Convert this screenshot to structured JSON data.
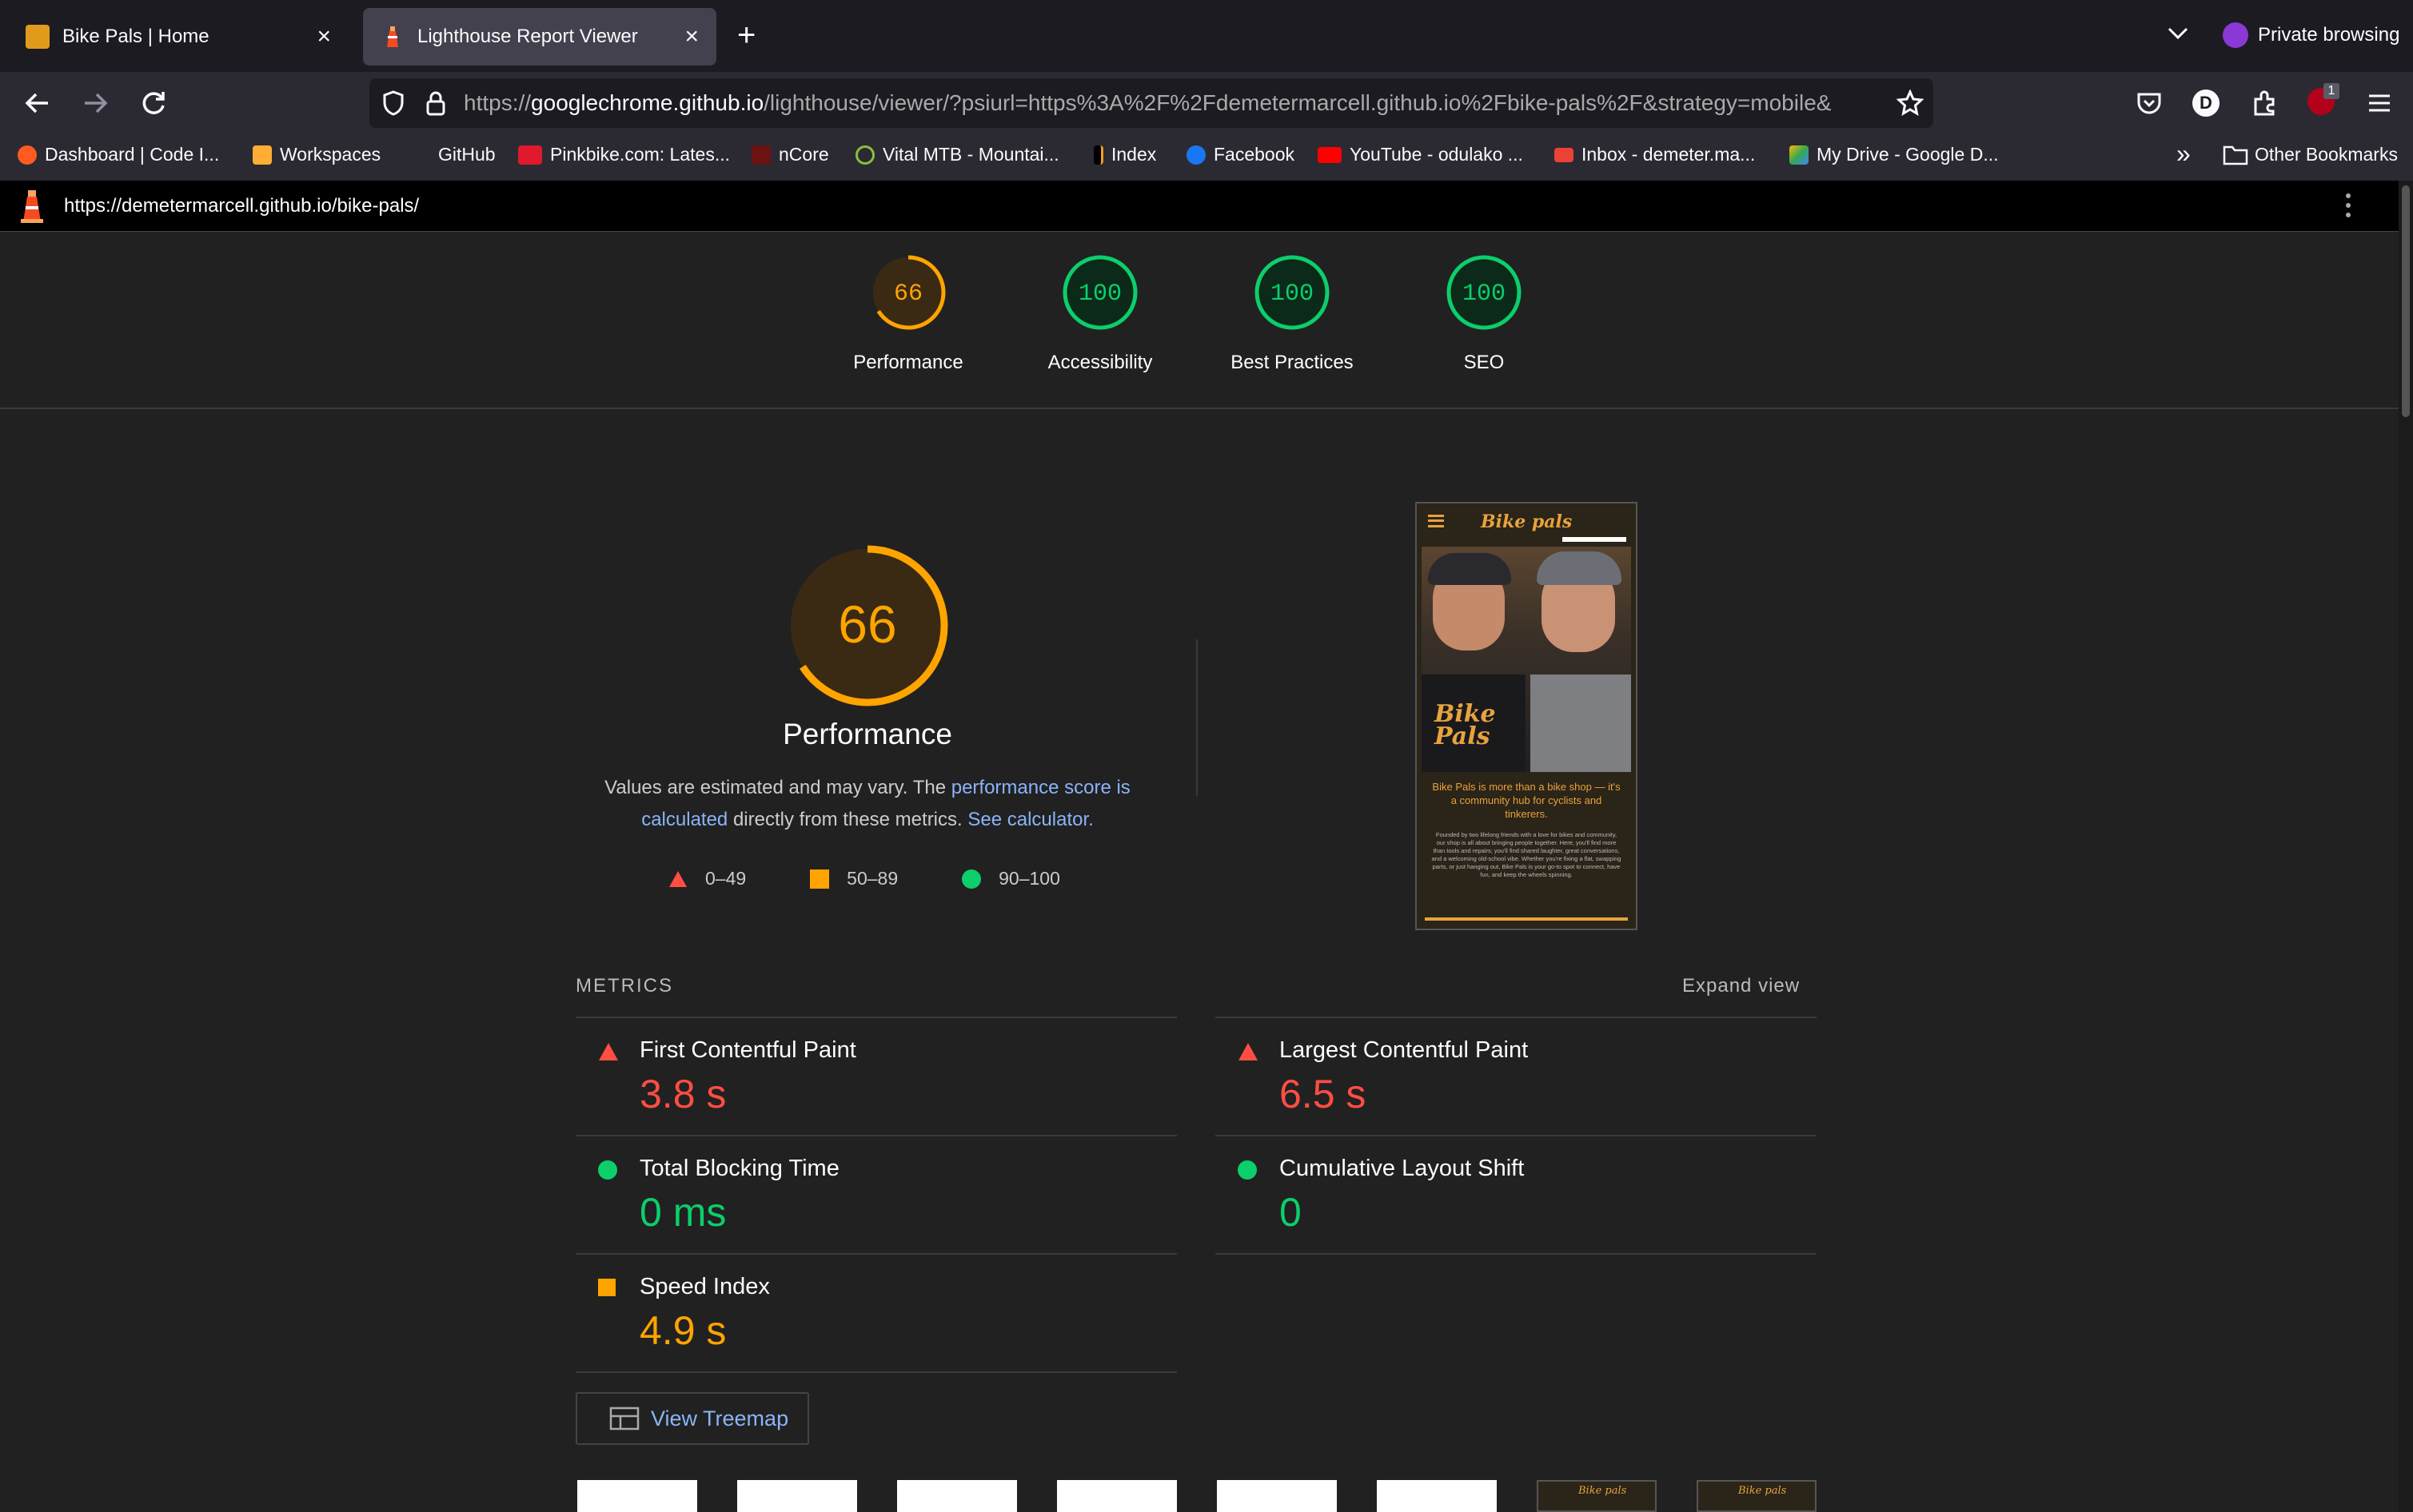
{
  "browser": {
    "tabs": [
      {
        "title": "Bike Pals | Home",
        "active": false
      },
      {
        "title": "Lighthouse Report Viewer",
        "active": true
      }
    ],
    "private_label": "Private browsing",
    "url_scheme": "https://",
    "url_host": "googlechrome.github.io",
    "url_rest": "/lighthouse/viewer/?psiurl=https%3A%2F%2Fdemetermarcell.github.io%2Fbike-pals%2F&strategy=mobile&",
    "bookmarks": [
      "Dashboard | Code I...",
      "Workspaces",
      "GitHub",
      "Pinkbike.com: Lates...",
      "nCore",
      "Vital MTB - Mountai...",
      "Index",
      "Facebook",
      "YouTube - odulako ...",
      "Inbox - demeter.ma...",
      "My Drive - Google D..."
    ],
    "other_bookmarks": "Other Bookmarks",
    "extension_badge": "1",
    "profile_letter": "D"
  },
  "lighthouse": {
    "report_url": "https://demetermarcell.github.io/bike-pals/",
    "scores": [
      {
        "label": "Performance",
        "value": "66",
        "color": "#ffa400",
        "fraction": 0.66
      },
      {
        "label": "Accessibility",
        "value": "100",
        "color": "#0cce6b",
        "fraction": 1.0
      },
      {
        "label": "Best Practices",
        "value": "100",
        "color": "#0cce6b",
        "fraction": 1.0
      },
      {
        "label": "SEO",
        "value": "100",
        "color": "#0cce6b",
        "fraction": 1.0
      }
    ],
    "main_score": "66",
    "main_label": "Performance",
    "desc_prefix": "Values are estimated and may vary. The ",
    "desc_link1": "performance score is calculated",
    "desc_mid": " directly from these metrics. ",
    "desc_link2": "See calculator.",
    "legend": [
      "0–49",
      "50–89",
      "90–100"
    ],
    "metrics_title": "METRICS",
    "expand_view": "Expand view",
    "metrics": [
      {
        "name": "First Contentful Paint",
        "value": "3.8 s",
        "status": "fail"
      },
      {
        "name": "Largest Contentful Paint",
        "value": "6.5 s",
        "status": "fail"
      },
      {
        "name": "Total Blocking Time",
        "value": "0 ms",
        "status": "pass"
      },
      {
        "name": "Cumulative Layout Shift",
        "value": "0",
        "status": "pass"
      },
      {
        "name": "Speed Index",
        "value": "4.9 s",
        "status": "average"
      }
    ],
    "treemap_button": "View Treemap",
    "screenshot": {
      "brand": "Bike pals",
      "logo_line1": "Bike",
      "logo_line2": "Pals",
      "tagline": "Bike Pals is more than a bike shop — it's a community hub for cyclists and tinkerers.",
      "body": "Founded by two lifelong friends with a love for bikes and community, our shop is all about bringing people together. Here, you'll find more than tools and repairs; you'll find shared laughter, great conversations, and a welcoming old-school vibe. Whether you're fixing a flat, swapping parts, or just hanging out, Bike Pals is your go-to spot to connect, have fun, and keep the wheels spinning."
    },
    "filmstrip_brand": "Bike pals"
  },
  "colors": {
    "fail": "#ff4e42",
    "average": "#ffa400",
    "pass": "#0cce6b",
    "link": "#8ab4f8"
  }
}
